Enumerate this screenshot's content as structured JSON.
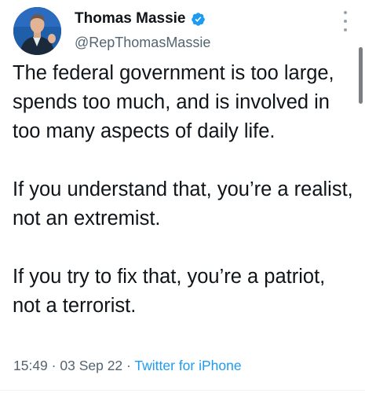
{
  "author": {
    "display_name": "Thomas Massie",
    "handle": "@RepThomasMassie",
    "verified": true
  },
  "tweet": {
    "paragraphs": [
      "The federal government is too large, spends too much, and is involved in too many aspects of daily life.",
      "If you understand that, you’re a realist, not an extremist.",
      "If you try to fix that, you’re a patriot, not a terrorist."
    ],
    "time": "15:49",
    "date": "03 Sep 22",
    "separator": "·",
    "source": "Twitter for iPhone"
  },
  "icons": {
    "verified": "verified-badge-icon",
    "more": "more-options-icon"
  },
  "colors": {
    "verified_badge": "#1d9bf0",
    "link": "#1d9bf0",
    "secondary_text": "#536471"
  }
}
